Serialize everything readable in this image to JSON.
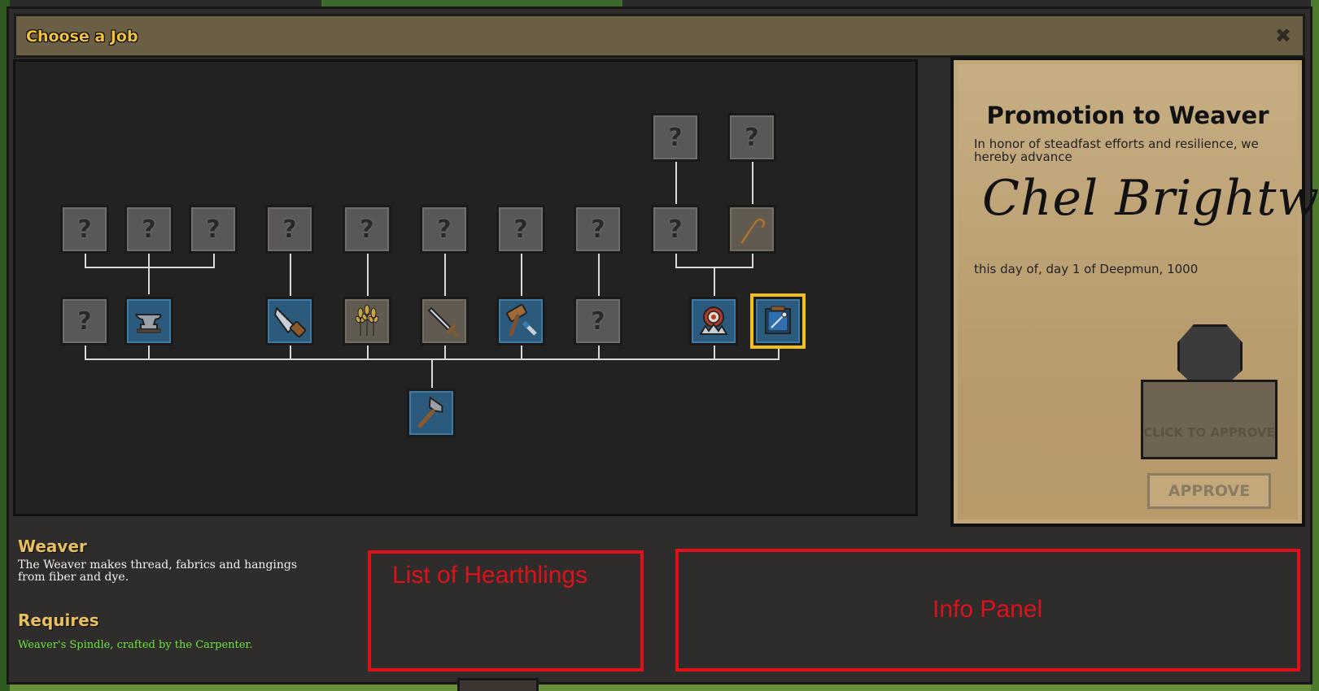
{
  "window": {
    "title": "Choose a Job",
    "close_label": "✖"
  },
  "tree": {
    "locked_glyph": "?",
    "icons": {
      "base": "hammer-icon",
      "blacksmith": "anvil-icon",
      "carpenter": "saw-icon",
      "farmer": "wheat-icon",
      "footman": "sword-icon",
      "mason": "mallet-chisel-icon",
      "trapper": "trap-icon",
      "weaver": "spindle-icon",
      "shepherd": "crook-icon"
    }
  },
  "certificate": {
    "heading": "Promotion to Weaver",
    "honor_text": "In honor of steadfast efforts and resilience, we hereby advance",
    "name": "Chel Brightwell",
    "date_text": "this day of, day 1 of Deepmun, 1000",
    "stamp_text": "CLICK TO APPROVE",
    "approve_label": "APPROVE"
  },
  "job_info": {
    "title": "Weaver",
    "description": "The Weaver makes thread, fabrics and hangings from fiber and dye.",
    "requires_title": "Requires",
    "requires_text": "Weaver's Spindle, crafted by the Carpenter."
  },
  "annotations": {
    "hearthlings_label": "List of Hearthlings",
    "info_panel_label": "Info Panel"
  },
  "colors": {
    "title_gold": "#f0c23a",
    "locked_node": "#5a5856",
    "unlocked_node": "#2c5a7c",
    "selected_border": "#f0c020",
    "requires_green": "#6be33c",
    "annotation_red": "#e0101a"
  }
}
